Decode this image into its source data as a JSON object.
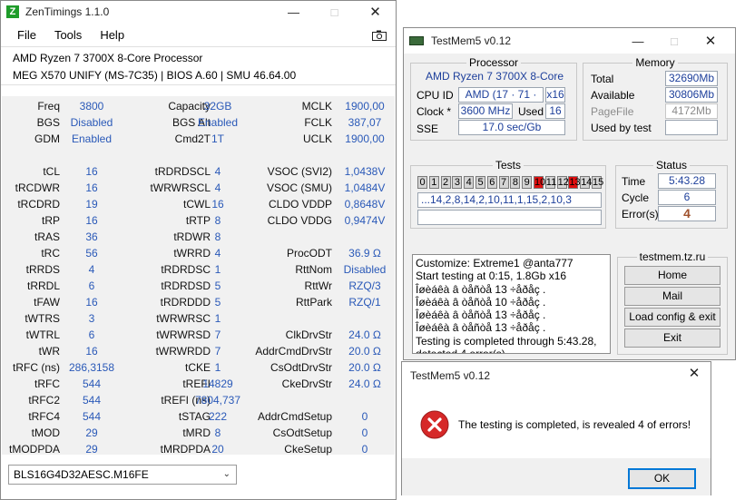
{
  "zentimings": {
    "title": "ZenTimings 1.1.0",
    "icon_letter": "Z",
    "menu": [
      "File",
      "Tools",
      "Help"
    ],
    "cpu": "AMD Ryzen 7 3700X 8-Core Processor",
    "board": "MEG X570 UNIFY (MS-7C35) | BIOS A.60 | SMU 46.64.00",
    "rows": [
      [
        "Freq",
        "3800",
        "Capacity",
        "32GB",
        "MCLK",
        "1900,00"
      ],
      [
        "BGS",
        "Disabled",
        "BGS Alt",
        "Enabled",
        "FCLK",
        "387,07"
      ],
      [
        "GDM",
        "Enabled",
        "Cmd2T",
        "1T",
        "UCLK",
        "1900,00"
      ],
      [
        "",
        "",
        "",
        "",
        "",
        ""
      ],
      [
        "tCL",
        "16",
        "tRDRDSCL",
        "4",
        "VSOC (SVI2)",
        "1,0438V"
      ],
      [
        "tRCDWR",
        "16",
        "tWRWRSCL",
        "4",
        "VSOC (SMU)",
        "1,0484V"
      ],
      [
        "tRCDRD",
        "19",
        "tCWL",
        "16",
        "CLDO VDDP",
        "0,8648V"
      ],
      [
        "tRP",
        "16",
        "tRTP",
        "8",
        "CLDO VDDG",
        "0,9474V"
      ],
      [
        "tRAS",
        "36",
        "tRDWR",
        "8",
        "",
        ""
      ],
      [
        "tRC",
        "56",
        "tWRRD",
        "4",
        "ProcODT",
        "36.9 Ω"
      ],
      [
        "tRRDS",
        "4",
        "tRDRDSC",
        "1",
        "RttNom",
        "Disabled"
      ],
      [
        "tRRDL",
        "6",
        "tRDRDSD",
        "5",
        "RttWr",
        "RZQ/3"
      ],
      [
        "tFAW",
        "16",
        "tRDRDDD",
        "5",
        "RttPark",
        "RZQ/1"
      ],
      [
        "tWTRS",
        "3",
        "tWRWRSC",
        "1",
        "",
        ""
      ],
      [
        "tWTRL",
        "6",
        "tWRWRSD",
        "7",
        "ClkDrvStr",
        "24.0 Ω"
      ],
      [
        "tWR",
        "16",
        "tWRWRDD",
        "7",
        "AddrCmdDrvStr",
        "20.0 Ω"
      ],
      [
        "tRFC (ns)",
        "286,3158",
        "tCKE",
        "1",
        "CsOdtDrvStr",
        "20.0 Ω"
      ],
      [
        "tRFC",
        "544",
        "tREFI",
        "14829",
        "CkeDrvStr",
        "24.0 Ω"
      ],
      [
        "tRFC2",
        "544",
        "tREFI (ns)",
        "7804,737",
        "",
        ""
      ],
      [
        "tRFC4",
        "544",
        "tSTAG",
        "222",
        "AddrCmdSetup",
        "0"
      ],
      [
        "tMOD",
        "29",
        "tMRD",
        "8",
        "CsOdtSetup",
        "0"
      ],
      [
        "tMODPDA",
        "29",
        "tMRDPDA",
        "20",
        "CkeSetup",
        "0"
      ]
    ],
    "dimm_select": "BLS16G4D32AESC.M16FE"
  },
  "testmem": {
    "title": "TestMem5 v0.12",
    "processor": {
      "group": "Processor",
      "name": "AMD Ryzen 7 3700X 8-Core",
      "cpu_id_label": "CPU ID",
      "cpu_id": "AMD  (17 · 71 · 0)",
      "threads": "x16",
      "clock_label": "Clock *",
      "clock": "3600 MHz",
      "used_label": "Used",
      "used": "16",
      "sse_label": "SSE",
      "sse": "17.0 sec/Gb"
    },
    "memory": {
      "group": "Memory",
      "total_label": "Total",
      "total": "32690Mb",
      "available_label": "Available",
      "available": "30806Mb",
      "pagefile_label": "PageFile",
      "pagefile": "4172Mb",
      "used_label": "Used by test",
      "used": ""
    },
    "tests": {
      "group": "Tests",
      "cells": [
        "0",
        "1",
        "2",
        "3",
        "4",
        "5",
        "6",
        "7",
        "8",
        "9",
        "10",
        "11",
        "12",
        "13",
        "14",
        "15"
      ],
      "error_cells": [
        10,
        13
      ],
      "sequence": "...14,2,8,14,2,10,11,1,15,2,10,3",
      "progress": ""
    },
    "status": {
      "group": "Status",
      "time_label": "Time",
      "time": "5:43.28",
      "cycle_label": "Cycle",
      "cycle": "6",
      "errors_label": "Error(s)",
      "errors": "4"
    },
    "log": [
      "Customize: Extreme1 @anta777",
      "Start testing at 0:15, 1.8Gb x16",
      "Îøèáêà â òåñòå 13 ÷åðåç .",
      "Îøèáêà â òåñòå 10 ÷åðåç .",
      "Îøèáêà â òåñòå 13 ÷åðåç .",
      "Îøèáêà â òåñòå 13 ÷åðåç .",
      "Testing is completed through 5:43.28,",
      "detected 4 error(s)."
    ],
    "site": "testmem.tz.ru",
    "buttons": {
      "home": "Home",
      "mail": "Mail",
      "load": "Load config & exit",
      "exit": "Exit"
    }
  },
  "dialog": {
    "title": "TestMem5 v0.12",
    "message": "The testing is completed, is revealed 4 of errors!",
    "ok": "OK"
  },
  "colors": {
    "value_blue": "#2a59b8",
    "error_red": "#e01010",
    "zen_green": "#1f9c2a"
  }
}
